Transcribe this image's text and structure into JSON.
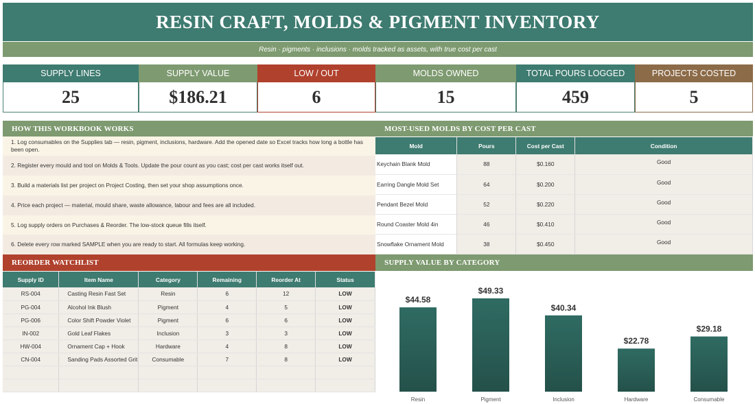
{
  "title": "RESIN CRAFT, MOLDS & PIGMENT INVENTORY",
  "subtitle": "Resin · pigments · inclusions · molds tracked as assets, with true cost per cast",
  "kpis": [
    {
      "label": "SUPPLY LINES",
      "value": "25",
      "color": "#3e7b70"
    },
    {
      "label": "SUPPLY VALUE",
      "value": "$186.21",
      "color": "#7e9a70"
    },
    {
      "label": "LOW / OUT",
      "value": "6",
      "color": "#b0412d"
    },
    {
      "label": "MOLDS OWNED",
      "value": "15",
      "color": "#7e9a70"
    },
    {
      "label": "TOTAL POURS LOGGED",
      "value": "459",
      "color": "#3e7b70"
    },
    {
      "label": "PROJECTS COSTED",
      "value": "5",
      "color": "#8c6b48"
    }
  ],
  "how": {
    "title": "HOW THIS WORKBOOK WORKS",
    "steps": [
      "1.  Log consumables on the Supplies tab — resin, pigment, inclusions, hardware. Add the opened date so Excel tracks how long a bottle has been open.",
      "2.  Register every mould and tool on Molds & Tools. Update the pour count as you cast; cost per cast works itself out.",
      "3.  Build a materials list per project on Project Costing, then set your shop assumptions once.",
      "4.  Price each project — material, mould share, waste allowance, labour and fees are all included.",
      "5.  Log supply orders on Purchases & Reorder. The low-stock queue fills itself.",
      "6.  Delete every row marked SAMPLE when you are ready to start. All formulas keep working."
    ]
  },
  "molds": {
    "title": "MOST-USED MOLDS BY COST PER CAST",
    "headers": [
      "Mold",
      "Pours",
      "Cost per Cast",
      "Condition"
    ],
    "rows": [
      [
        "Keychain Blank Mold",
        "88",
        "$0.160",
        "Good"
      ],
      [
        "Earring Dangle Mold Set",
        "64",
        "$0.200",
        "Good"
      ],
      [
        "Pendant Bezel Mold",
        "52",
        "$0.220",
        "Good"
      ],
      [
        "Round Coaster Mold 4in",
        "46",
        "$0.410",
        "Good"
      ],
      [
        "Snowflake Ornament Mold",
        "38",
        "$0.450",
        "Good"
      ]
    ]
  },
  "reorder": {
    "title": "REORDER WATCHLIST",
    "headers": [
      "Supply ID",
      "Item Name",
      "Category",
      "Remaining",
      "Reorder At",
      "Status"
    ],
    "rows": [
      [
        "RS-004",
        "Casting Resin Fast Set",
        "Resin",
        "6",
        "12",
        "LOW"
      ],
      [
        "PG-004",
        "Alcohol Ink Blush",
        "Pigment",
        "4",
        "5",
        "LOW"
      ],
      [
        "PG-006",
        "Color Shift Powder Violet",
        "Pigment",
        "6",
        "6",
        "LOW"
      ],
      [
        "IN-002",
        "Gold Leaf Flakes",
        "Inclusion",
        "3",
        "3",
        "LOW"
      ],
      [
        "HW-004",
        "Ornament Cap + Hook",
        "Hardware",
        "4",
        "8",
        "LOW"
      ],
      [
        "CN-004",
        "Sanding Pads Assorted Grit",
        "Consumable",
        "7",
        "8",
        "LOW"
      ]
    ]
  },
  "chart_title": "SUPPLY VALUE BY CATEGORY",
  "chart_data": {
    "type": "bar",
    "title": "SUPPLY VALUE BY CATEGORY",
    "categories": [
      "Resin",
      "Pigment",
      "Inclusion",
      "Hardware",
      "Consumable"
    ],
    "values": [
      44.58,
      49.33,
      40.34,
      22.78,
      29.18
    ],
    "labels": [
      "$44.58",
      "$49.33",
      "$40.34",
      "$22.78",
      "$29.18"
    ],
    "ylim": [
      0,
      49.33
    ],
    "grid": false,
    "bar_color": "#2f6b62"
  },
  "colors": {
    "teal": "#3e7b70",
    "sage": "#7e9a70",
    "red": "#b0412d",
    "brown": "#8c6b48",
    "low_text": "#b0341f"
  }
}
